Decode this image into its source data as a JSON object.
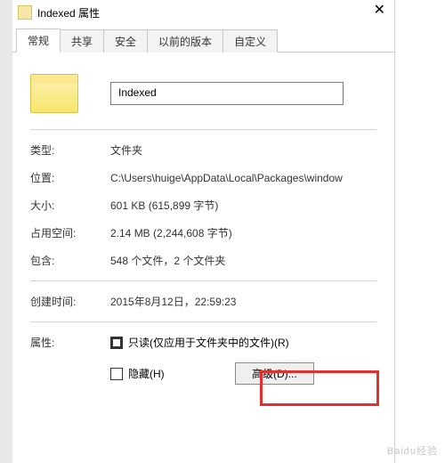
{
  "titlebar": {
    "title": "Indexed 属性",
    "close": "✕"
  },
  "tabs": [
    {
      "label": "常规",
      "active": true
    },
    {
      "label": "共享"
    },
    {
      "label": "安全"
    },
    {
      "label": "以前的版本"
    },
    {
      "label": "自定义"
    }
  ],
  "name_field": "Indexed",
  "rows": {
    "type": {
      "label": "类型:",
      "value": "文件夹"
    },
    "location": {
      "label": "位置:",
      "value": "C:\\Users\\huige\\AppData\\Local\\Packages\\window"
    },
    "size": {
      "label": "大小:",
      "value": "601 KB (615,899 字节)"
    },
    "ondisk": {
      "label": "占用空间:",
      "value": "2.14 MB (2,244,608 字节)"
    },
    "contains": {
      "label": "包含:",
      "value": "548 个文件，2 个文件夹"
    },
    "created": {
      "label": "创建时间:",
      "value": "2015年8月12日，22:59:23"
    }
  },
  "attributes": {
    "label": "属性:",
    "readonly": "只读(仅应用于文件夹中的文件)(R)",
    "hidden": "隐藏(H)",
    "advanced": "高级(D)..."
  },
  "watermark": "Baidu经验"
}
